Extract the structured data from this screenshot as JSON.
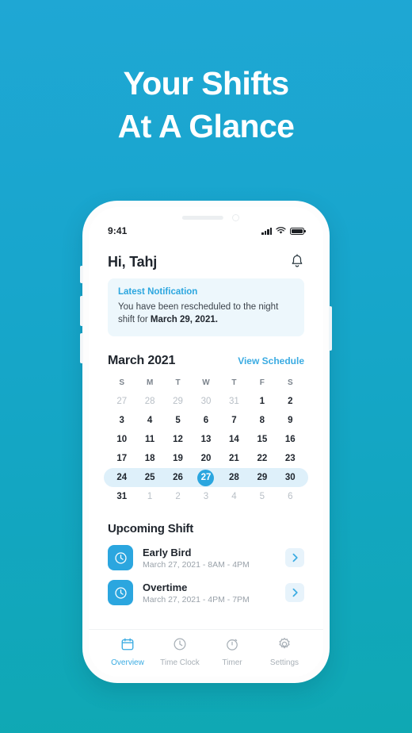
{
  "promo": {
    "line1": "Your Shifts",
    "line2": "At A Glance"
  },
  "theme": {
    "bg_top": "#1FA7D4",
    "bg_bottom": "#0FA8B3",
    "accent": "#2BA6DF",
    "link": "#3AABE2",
    "notif_bg": "#EDF7FC",
    "highlight_band": "#DEF0FA"
  },
  "phone": {
    "statusbar": {
      "time": "9:41",
      "signal_icon": "signal-bars-icon",
      "wifi_icon": "wifi-icon",
      "battery_icon": "battery-full-icon"
    },
    "header": {
      "greeting": "Hi, Tahj",
      "bell_icon": "bell-icon"
    },
    "notification": {
      "title": "Latest Notification",
      "body_prefix": "You have been rescheduled to the night shift for ",
      "body_bold": "March 29, 2021."
    },
    "calendar": {
      "title": "March 2021",
      "view_link": "View Schedule",
      "weekdays": [
        "S",
        "M",
        "T",
        "W",
        "T",
        "F",
        "S"
      ],
      "weeks": [
        [
          {
            "d": "27",
            "muted": true
          },
          {
            "d": "28",
            "muted": true
          },
          {
            "d": "29",
            "muted": true
          },
          {
            "d": "30",
            "muted": true
          },
          {
            "d": "31",
            "muted": true
          },
          {
            "d": "1",
            "muted": false
          },
          {
            "d": "2",
            "muted": false
          }
        ],
        [
          {
            "d": "3",
            "muted": false
          },
          {
            "d": "4",
            "muted": false
          },
          {
            "d": "5",
            "muted": false
          },
          {
            "d": "6",
            "muted": false
          },
          {
            "d": "7",
            "muted": false
          },
          {
            "d": "8",
            "muted": false
          },
          {
            "d": "9",
            "muted": false
          }
        ],
        [
          {
            "d": "10",
            "muted": false
          },
          {
            "d": "11",
            "muted": false
          },
          {
            "d": "12",
            "muted": false
          },
          {
            "d": "13",
            "muted": false
          },
          {
            "d": "14",
            "muted": false
          },
          {
            "d": "15",
            "muted": false
          },
          {
            "d": "16",
            "muted": false
          }
        ],
        [
          {
            "d": "17",
            "muted": false
          },
          {
            "d": "18",
            "muted": false
          },
          {
            "d": "19",
            "muted": false
          },
          {
            "d": "20",
            "muted": false
          },
          {
            "d": "21",
            "muted": false
          },
          {
            "d": "22",
            "muted": false
          },
          {
            "d": "23",
            "muted": false
          }
        ],
        [
          {
            "d": "24",
            "muted": false
          },
          {
            "d": "25",
            "muted": false
          },
          {
            "d": "26",
            "muted": false
          },
          {
            "d": "27",
            "muted": false,
            "today": true
          },
          {
            "d": "28",
            "muted": false
          },
          {
            "d": "29",
            "muted": false
          },
          {
            "d": "30",
            "muted": false
          }
        ],
        [
          {
            "d": "31",
            "muted": false
          },
          {
            "d": "1",
            "muted": true
          },
          {
            "d": "2",
            "muted": true
          },
          {
            "d": "3",
            "muted": true
          },
          {
            "d": "4",
            "muted": true
          },
          {
            "d": "5",
            "muted": true
          },
          {
            "d": "6",
            "muted": true
          }
        ]
      ],
      "highlight_week_index": 4
    },
    "upcoming": {
      "title": "Upcoming Shift",
      "shifts": [
        {
          "name": "Early Bird",
          "time": "March 27, 2021 - 8AM - 4PM",
          "icon": "clock-icon",
          "chevron": "chevron-right-icon"
        },
        {
          "name": "Overtime",
          "time": "March 27, 2021 - 4PM - 7PM",
          "icon": "clock-icon",
          "chevron": "chevron-right-icon"
        }
      ]
    },
    "tabs": [
      {
        "label": "Overview",
        "icon": "calendar-icon",
        "active": true
      },
      {
        "label": "Time Clock",
        "icon": "clock-icon",
        "active": false
      },
      {
        "label": "Timer",
        "icon": "stopwatch-icon",
        "active": false
      },
      {
        "label": "Settings",
        "icon": "gear-icon",
        "active": false
      }
    ]
  }
}
